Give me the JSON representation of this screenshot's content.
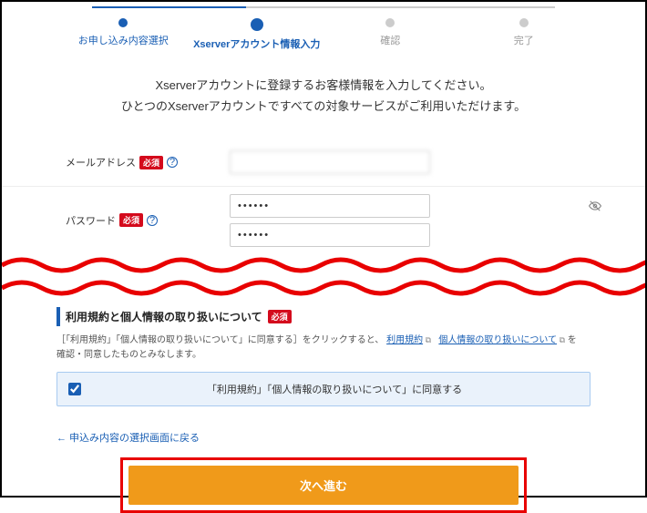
{
  "stepper": {
    "steps": [
      {
        "label": "お申し込み内容選択"
      },
      {
        "label": "Xserverアカウント情報入力"
      },
      {
        "label": "確認"
      },
      {
        "label": "完了"
      }
    ]
  },
  "intro": {
    "line1": "Xserverアカウントに登録するお客様情報を入力してください。",
    "line2": "ひとつのXserverアカウントですべての対象サービスがご利用いただけます。"
  },
  "fields": {
    "email": {
      "label": "メールアドレス",
      "required": "必須",
      "value": ""
    },
    "password": {
      "label": "パスワード",
      "required": "必須",
      "value1": "••••••",
      "value2": "••••••"
    }
  },
  "terms": {
    "heading": "利用規約と個人情報の取り扱いについて",
    "required": "必須",
    "desc_prefix": "［「利用規約」「個人情報の取り扱いについて」に同意する］をクリックすると、",
    "link1": "利用規約",
    "link2": "個人情報の取り扱いについて",
    "desc_suffix1": " を",
    "desc_suffix2": "確認・同意したものとみなします。",
    "consent_label": "「利用規約」「個人情報の取り扱いについて」に同意する"
  },
  "back_link": "← 申込み内容の選択画面に戻る",
  "submit": "次へ進む"
}
